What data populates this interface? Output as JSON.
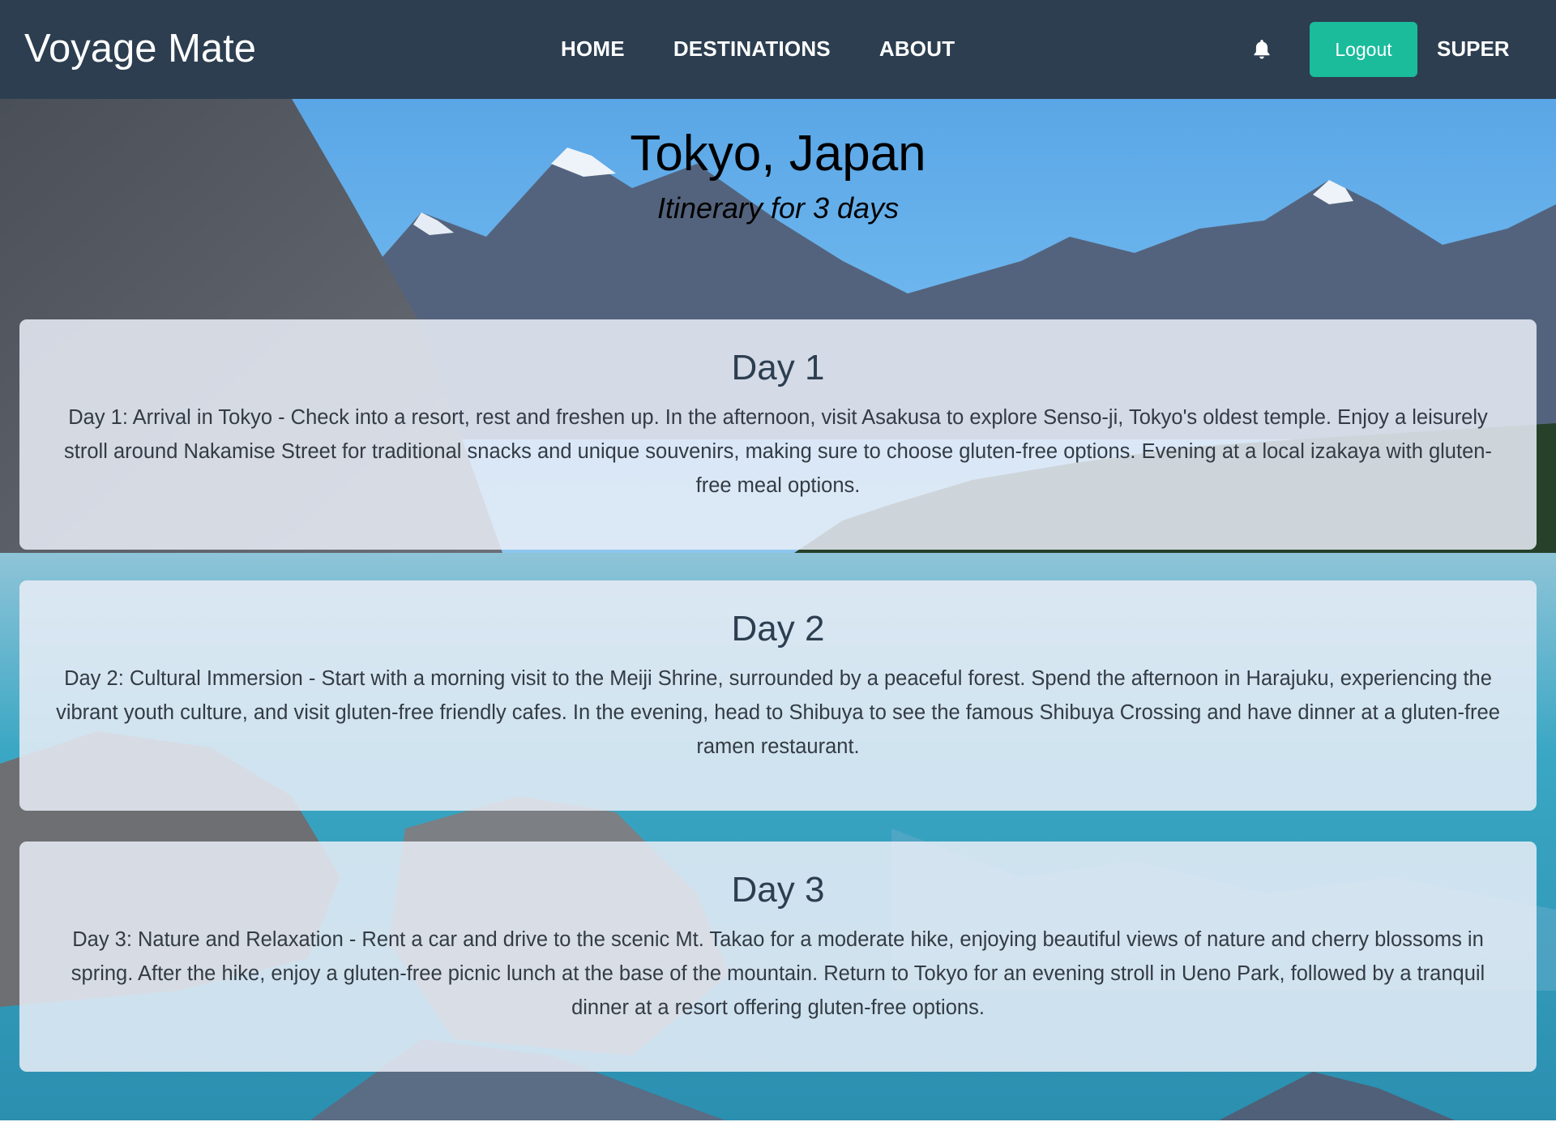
{
  "navbar": {
    "brand": "Voyage Mate",
    "links": [
      "HOME",
      "DESTINATIONS",
      "ABOUT"
    ],
    "logout_label": "Logout",
    "user_name": "SUPER",
    "bell_icon": "bell-icon",
    "background_color": "#2c3e50",
    "logout_color": "#1abc9c"
  },
  "header": {
    "title": "Tokyo, Japan",
    "subtitle": "Itinerary for 3 days"
  },
  "days": [
    {
      "title": "Day 1",
      "text": "Day 1: Arrival in Tokyo - Check into a resort, rest and freshen up. In the afternoon, visit Asakusa to explore Senso-ji, Tokyo's oldest temple. Enjoy a leisurely stroll around Nakamise Street for traditional snacks and unique souvenirs, making sure to choose gluten-free options. Evening at a local izakaya with gluten-free meal options."
    },
    {
      "title": "Day 2",
      "text": "Day 2: Cultural Immersion - Start with a morning visit to the Meiji Shrine, surrounded by a peaceful forest. Spend the afternoon in Harajuku, experiencing the vibrant youth culture, and visit gluten-free friendly cafes. In the evening, head to Shibuya to see the famous Shibuya Crossing and have dinner at a gluten-free ramen restaurant."
    },
    {
      "title": "Day 3",
      "text": "Day 3: Nature and Relaxation - Rent a car and drive to the scenic Mt. Takao for a moderate hike, enjoying beautiful views of nature and cherry blossoms in spring. After the hike, enjoy a gluten-free picnic lunch at the base of the mountain. Return to Tokyo for an evening stroll in Ueno Park, followed by a tranquil dinner at a resort offering gluten-free options."
    }
  ]
}
